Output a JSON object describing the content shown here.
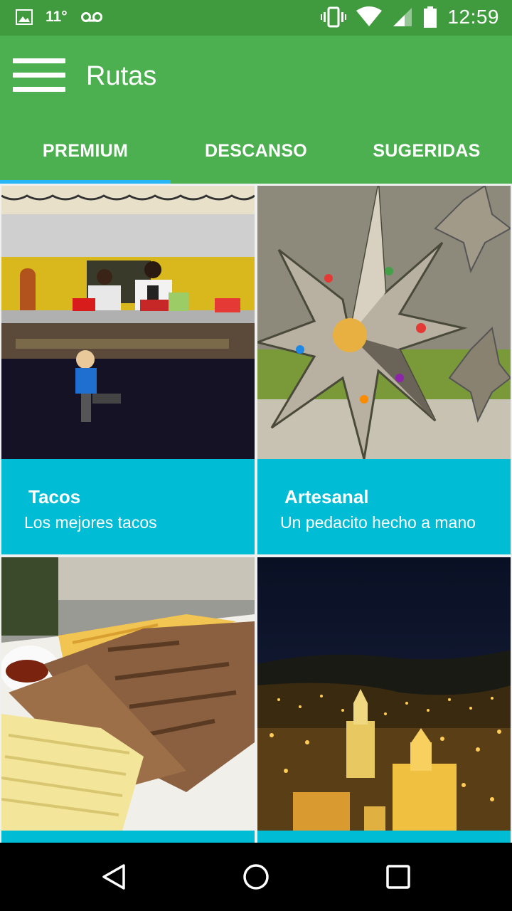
{
  "status_bar": {
    "temperature": "11°",
    "time": "12:59",
    "icons": [
      "image-icon",
      "voicemail-icon",
      "vibrate-icon",
      "wifi-icon",
      "signal-icon",
      "battery-icon"
    ]
  },
  "app_bar": {
    "title": "Rutas",
    "menu_icon": "hamburger-menu-icon",
    "background": "#4caf50",
    "status_background": "#3f9b3d"
  },
  "tabs": [
    {
      "label": "PREMIUM",
      "active": true
    },
    {
      "label": "DESCANSO",
      "active": false
    },
    {
      "label": "SUGERIDAS",
      "active": false
    }
  ],
  "tab_indicator_color": "#29b6f6",
  "cards": [
    {
      "title": "Tacos",
      "subtitle": "Los mejores tacos",
      "image": "taco-stand-photo"
    },
    {
      "title": "Artesanal",
      "subtitle": "Un pedacito hecho a mano",
      "image": "tin-star-lantern-photo"
    },
    {
      "title": "",
      "subtitle": "",
      "image": "grilled-ribs-corn-photo"
    },
    {
      "title": "",
      "subtitle": "",
      "image": "city-night-photo"
    }
  ],
  "card_color": "#00bcd4",
  "nav_bar": {
    "buttons": [
      "back-icon",
      "home-icon",
      "recents-icon"
    ]
  }
}
